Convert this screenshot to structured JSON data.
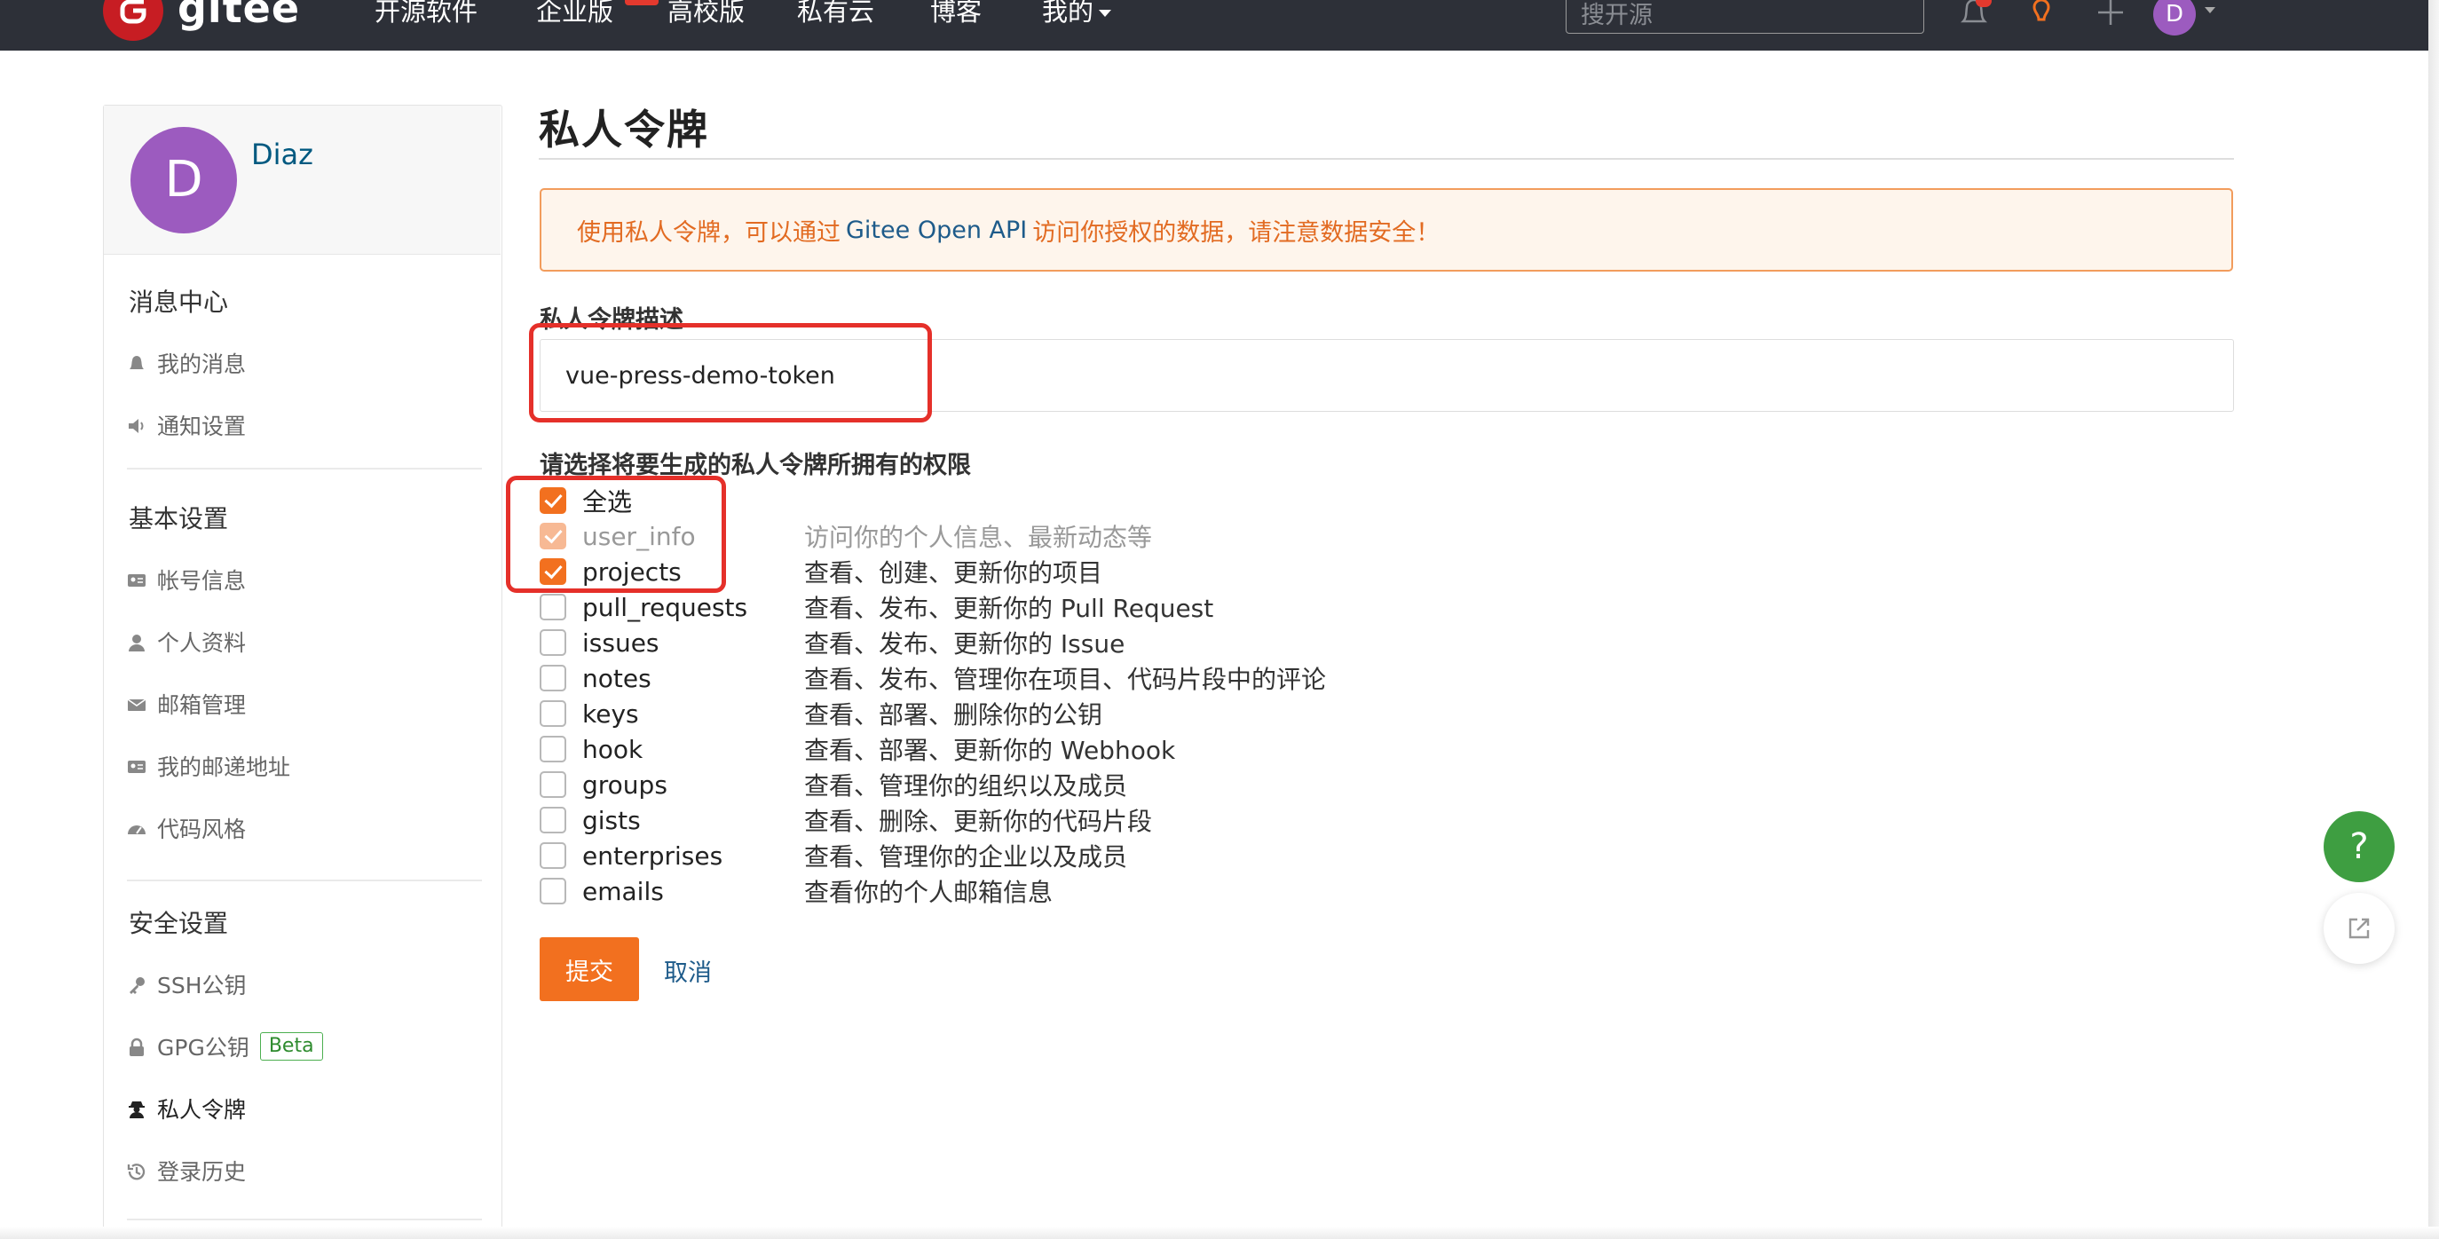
{
  "nav": {
    "logo_text": "gitee",
    "links": [
      "开源软件",
      "企业版",
      "高校版",
      "私有云",
      "博客",
      "我的"
    ],
    "search_placeholder": "搜开源",
    "avatar_letter": "D"
  },
  "sidebar": {
    "user": {
      "avatar_letter": "D",
      "name": "Diaz"
    },
    "sections": [
      {
        "title": "消息中心",
        "items": [
          "我的消息",
          "通知设置"
        ]
      },
      {
        "title": "基本设置",
        "items": [
          "帐号信息",
          "个人资料",
          "邮箱管理",
          "我的邮递地址",
          "代码风格"
        ]
      },
      {
        "title": "安全设置",
        "items": [
          "SSH公钥",
          "GPG公钥",
          "私人令牌",
          "登录历史"
        ],
        "badge": "Beta"
      }
    ]
  },
  "main": {
    "title": "私人令牌",
    "notice": {
      "before": "使用私人令牌，可以通过",
      "api": "Gitee Open API",
      "after": "访问你授权的数据，请注意数据安全！"
    },
    "description_label": "私人令牌描述",
    "description_value": "vue-press-demo-token",
    "permissions_label": "请选择将要生成的私人令牌所拥有的权限",
    "select_all": "全选",
    "permissions": [
      {
        "name": "user_info",
        "desc": "访问你的个人信息、最新动态等",
        "checked": true,
        "disabled": true
      },
      {
        "name": "projects",
        "desc": "查看、创建、更新你的项目",
        "checked": true
      },
      {
        "name": "pull_requests",
        "desc": "查看、发布、更新你的 Pull Request",
        "checked": false
      },
      {
        "name": "issues",
        "desc": "查看、发布、更新你的 Issue",
        "checked": false
      },
      {
        "name": "notes",
        "desc": "查看、发布、管理你在项目、代码片段中的评论",
        "checked": false
      },
      {
        "name": "keys",
        "desc": "查看、部署、删除你的公钥",
        "checked": false
      },
      {
        "name": "hook",
        "desc": "查看、部署、更新你的 Webhook",
        "checked": false
      },
      {
        "name": "groups",
        "desc": "查看、管理你的组织以及成员",
        "checked": false
      },
      {
        "name": "gists",
        "desc": "查看、删除、更新你的代码片段",
        "checked": false
      },
      {
        "name": "enterprises",
        "desc": "查看、管理你的企业以及成员",
        "checked": false
      },
      {
        "name": "emails",
        "desc": "查看你的个人邮箱信息",
        "checked": false
      }
    ],
    "submit_label": "提交",
    "cancel_label": "取消"
  },
  "fab": {
    "help_label": "?"
  },
  "colors": {
    "accent": "#f2701f",
    "nav_bg": "#2d3038",
    "annotation": "#e5302a",
    "help": "#3e9e41"
  }
}
